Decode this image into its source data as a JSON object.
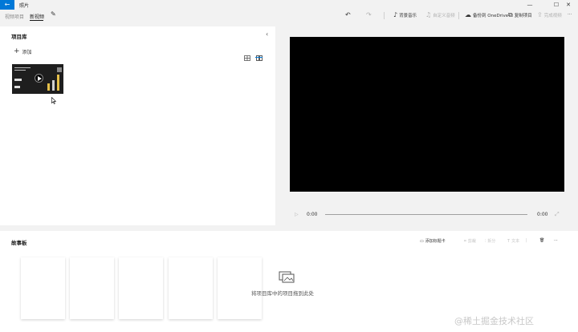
{
  "window": {
    "back_icon": "arrow-left-icon",
    "title": "照片",
    "controls": [
      "—",
      "☐",
      "✕"
    ]
  },
  "toolbar": {
    "tabs": [
      {
        "label": "视频项目",
        "active": false
      },
      {
        "label": "新视频",
        "active": true
      }
    ],
    "edit_icon": "pencil-icon",
    "undo_icon": "undo-icon",
    "redo_icon": "redo-icon",
    "find_media": "背景音乐",
    "custom_audio": "自定义音频",
    "backup_onedrive": "备份到 OneDrive",
    "copy_project": "复制项目",
    "finish_video": "完成视频",
    "more": "···"
  },
  "library": {
    "title": "项目库",
    "add_label": "添加",
    "collapse_icon": "chevron-left-icon",
    "view_small_icon": "grid-small-icon",
    "view_large_icon": "grid-large-icon",
    "selected_view": "large"
  },
  "player": {
    "time_start": "0:00",
    "time_end": "0:00",
    "play_icon": "play-icon",
    "fullscreen_icon": "fullscreen-icon"
  },
  "storyboard": {
    "title": "故事板",
    "add_title_card": "添加标题卡",
    "trim": "剪裁",
    "split": "拆分",
    "text": "文本",
    "delete_icon": "trash-icon",
    "more": "···",
    "drop_hint": "将项目库中的项目拖到此处"
  },
  "watermark": "@稀土掘金技术社区",
  "colors": {
    "accent": "#0078d7",
    "preview_bg": "#000000",
    "panel_bg": "#ffffff",
    "app_bg": "#f2f2f2"
  }
}
